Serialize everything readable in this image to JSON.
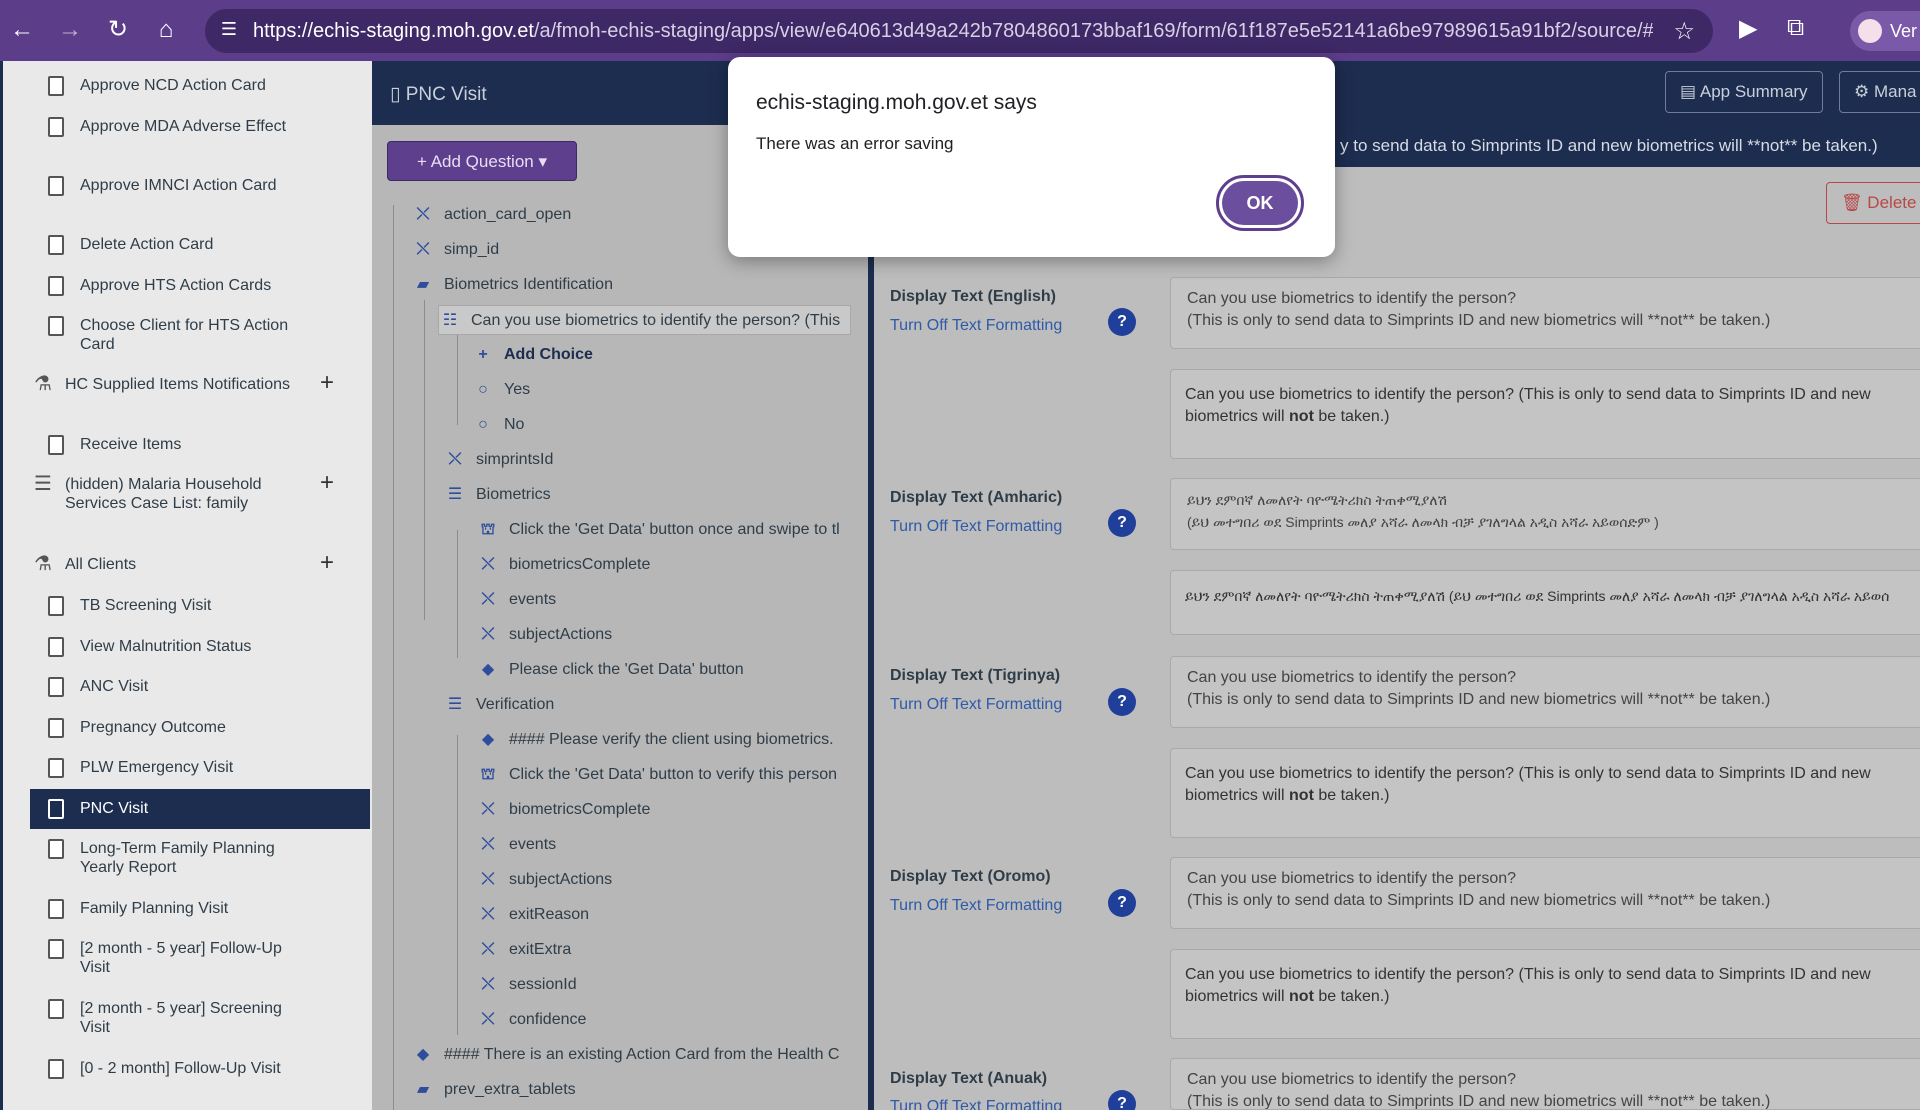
{
  "browser": {
    "back_icon": "←",
    "forward_icon": "→",
    "reload_icon": "↻",
    "home_icon": "⌂",
    "site_icon": "☰",
    "url_host": "https://echis-staging.moh.gov.et",
    "url_path": "/a/fmoh-echis-staging/apps/view/e640613d49a242b7804860173bbaf169/form/61f187e5e52141a6be97989615a91bf2/source/#form/...",
    "star_icon": "☆",
    "profile_label": "Ver"
  },
  "sidebar": {
    "items": [
      {
        "label": "Approve NCD Action Card"
      },
      {
        "label": "Approve MDA Adverse Effect"
      },
      {
        "label": "Approve IMNCI Action Card"
      },
      {
        "label": "Delete Action Card"
      },
      {
        "label": "Approve HTS Action Cards"
      },
      {
        "label": "Choose Client for HTS Action Card"
      }
    ],
    "module_hc": {
      "label": "HC Supplied Items Notifications",
      "add": "+"
    },
    "receive_items": "Receive Items",
    "module_malaria": {
      "label": "(hidden) Malaria Household Services Case List: family",
      "add": "+"
    },
    "module_all_clients": {
      "label": "All Clients",
      "add": "+"
    },
    "forms": [
      {
        "label": "TB Screening Visit"
      },
      {
        "label": "View Malnutrition Status"
      },
      {
        "label": "ANC Visit"
      },
      {
        "label": "Pregnancy Outcome"
      },
      {
        "label": "PLW Emergency Visit"
      },
      {
        "label": "PNC Visit"
      },
      {
        "label": "Long-Term Family Planning Yearly Report"
      },
      {
        "label": "Family Planning Visit"
      },
      {
        "label": "[2 month - 5 year] Follow-Up Visit"
      },
      {
        "label": "[2 month - 5 year] Screening Visit"
      },
      {
        "label": "[0 - 2 month] Follow-Up Visit"
      }
    ]
  },
  "form_header": {
    "title": "PNC Visit",
    "app_summary": "App Summary",
    "manage": "Mana"
  },
  "tree": {
    "add_question": "+ Add Question ▾",
    "rows": [
      {
        "label": "action_card_open",
        "icon": "x"
      },
      {
        "label": "simp_id",
        "icon": "x"
      },
      {
        "label": "Biometrics Identification",
        "icon": "folder"
      },
      {
        "label": "Can you use biometrics to identify the person? (This",
        "icon": "list"
      },
      {
        "label": "Add Choice",
        "icon": "+"
      },
      {
        "label": "Yes",
        "icon": "o"
      },
      {
        "label": "No",
        "icon": "o"
      },
      {
        "label": "simprintsId",
        "icon": "x"
      },
      {
        "label": "Biometrics",
        "icon": "group"
      },
      {
        "label": "Click the 'Get Data' button once and swipe to tl",
        "icon": "android"
      },
      {
        "label": "biometricsComplete",
        "icon": "x"
      },
      {
        "label": "events",
        "icon": "x"
      },
      {
        "label": "subjectActions",
        "icon": "x"
      },
      {
        "label": "Please click the 'Get Data' button",
        "icon": "tag"
      },
      {
        "label": "Verification",
        "icon": "group"
      },
      {
        "label": "#### Please verify the client using biometrics.",
        "icon": "tag"
      },
      {
        "label": "Click the 'Get Data' button to verify this person",
        "icon": "android"
      },
      {
        "label": "biometricsComplete",
        "icon": "x"
      },
      {
        "label": "events",
        "icon": "x"
      },
      {
        "label": "subjectActions",
        "icon": "x"
      },
      {
        "label": "exitReason",
        "icon": "x"
      },
      {
        "label": "exitExtra",
        "icon": "x"
      },
      {
        "label": "sessionId",
        "icon": "x"
      },
      {
        "label": "confidence",
        "icon": "x"
      },
      {
        "label": "#### There is an existing Action Card from the Health C",
        "icon": "tag"
      },
      {
        "label": "prev_extra_tablets",
        "icon": "folder"
      }
    ]
  },
  "props": {
    "notice": "y to send data to Simprints ID and new biometrics will **not** be taken.)",
    "delete": "🗑 Delete",
    "turn_off": "Turn Off Text Formatting",
    "help": "?",
    "fields": [
      {
        "label": "Display Text (English)",
        "input": "Can you use biometrics to identify the person?\n(This is only to send data to Simprints ID and new biometrics will **not** be taken.)",
        "preview_a": "Can you use biometrics to identify the person? (This is only to send data to Simprints ID and new biometrics",
        "preview_b": "will ",
        "preview_bold": "not",
        "preview_c": " be taken.)"
      },
      {
        "label": "Display Text (Amharic)",
        "input": "ይህን ደምበኛ ለመለየት ባዮሜትሪክስ ትጠቀሚያለሽ\n(ይህ መተግበሪ ወደ Simprints መለያ አሻራ ለመላክ ብቻ ያገለግላል አዲስ አሻራ አይወሰድም )",
        "preview_a": "ይህን ደምበኛ ለመለየት ባዮሜትሪክስ ትጠቀሚያለሽ (ይህ መተግበሪ ወደ Simprints መለያ አሻራ ለመላክ ብቻ ያገለግላል አዲስ አሻራ አይወሰ"
      },
      {
        "label": "Display Text (Tigrinya)",
        "input": "Can you use biometrics to identify the person?\n(This is only to send data to Simprints ID and new biometrics will **not** be taken.)",
        "preview_a": "Can you use biometrics to identify the person? (This is only to send data to Simprints ID and new biometrics",
        "preview_b": "will ",
        "preview_bold": "not",
        "preview_c": " be taken.)"
      },
      {
        "label": "Display Text (Oromo)",
        "input": "Can you use biometrics to identify the person?\n(This is only to send data to Simprints ID and new biometrics will **not** be taken.)",
        "preview_a": "Can you use biometrics to identify the person? (This is only to send data to Simprints ID and new biometrics",
        "preview_b": "will ",
        "preview_bold": "not",
        "preview_c": " be taken.)"
      },
      {
        "label": "Display Text (Anuak)",
        "input": "Can you use biometrics to identify the person?\n(This is only to send data to Simprints ID and new biometrics will **not** be taken.)"
      }
    ]
  },
  "dialog": {
    "title": "echis-staging.moh.gov.et says",
    "message": "There was an error saving",
    "ok": "OK"
  }
}
